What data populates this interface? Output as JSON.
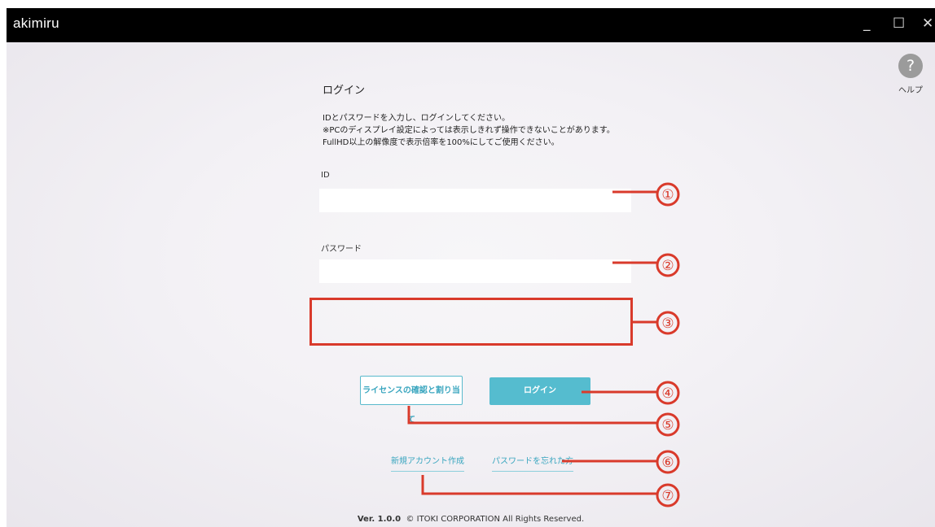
{
  "window": {
    "title": "akimiru",
    "minimize_glyph": "_",
    "maximize_glyph": "☐",
    "close_glyph": "✕"
  },
  "help": {
    "icon_glyph": "?",
    "label": "ヘルプ"
  },
  "login": {
    "heading": "ログイン",
    "description_lines": [
      "IDとパスワードを入力し、ログインしてください。",
      "※PCのディスプレイ設定によっては表示しきれず操作できないことがあります。",
      "FullHD以上の解像度で表示倍率を100%にしてご使用ください。"
    ],
    "id_label": "ID",
    "id_value": "",
    "password_label": "パスワード",
    "password_value": ""
  },
  "buttons": {
    "license": "ライセンスの確認と割り当て",
    "login": "ログイン"
  },
  "links": {
    "new_account": "新規アカウント作成",
    "forgot_password": "パスワードを忘れた方"
  },
  "footer": {
    "version": "Ver. 1.0.0",
    "copyright": "© ITOKI CORPORATION All Rights Reserved."
  },
  "annotations": {
    "color": "#d93a2b",
    "markers": [
      "①",
      "②",
      "③",
      "④",
      "⑤",
      "⑥",
      "⑦"
    ]
  },
  "colors": {
    "accent": "#55bccf",
    "annotation": "#d93a2b"
  }
}
